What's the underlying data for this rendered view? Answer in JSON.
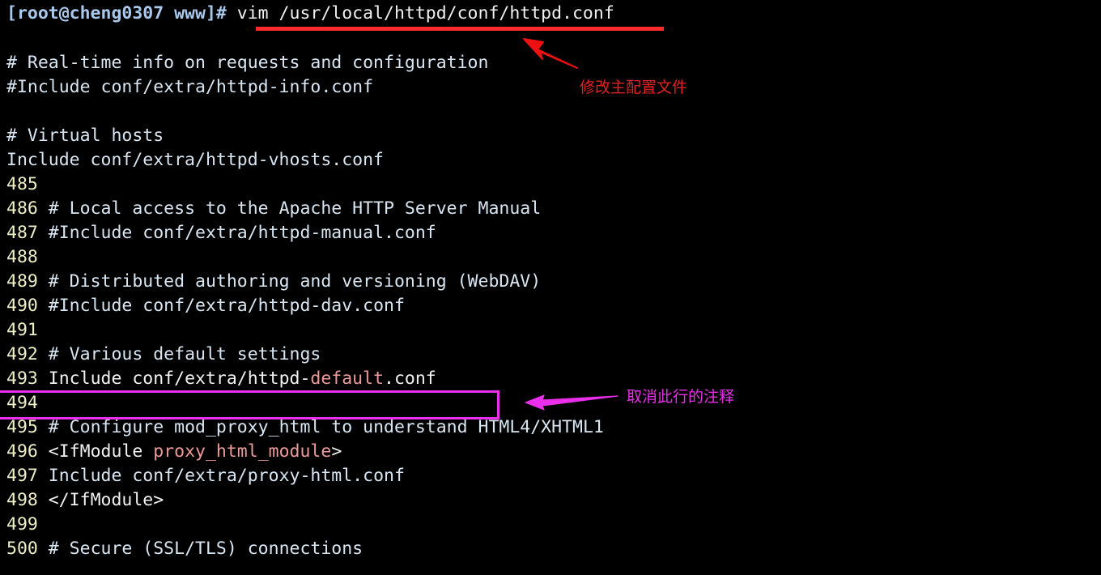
{
  "terminal": {
    "background_color": "#000000",
    "prompt": {
      "user_host": "[root@cheng0307 www]#",
      "command": "vim /usr/local/httpd/conf/httpd.conf"
    },
    "scrollback": [
      {
        "text": "# Real-time info on requests and configuration"
      },
      {
        "text": "#Include conf/extra/httpd-info.conf"
      },
      {
        "text": ""
      },
      {
        "text": "# Virtual hosts"
      },
      {
        "text": "Include conf/extra/httpd-vhosts.conf"
      }
    ],
    "numbered_lines": [
      {
        "num": "485",
        "text": ""
      },
      {
        "num": "486",
        "text": "# Local access to the Apache HTTP Server Manual"
      },
      {
        "num": "487",
        "text": "#Include conf/extra/httpd-manual.conf"
      },
      {
        "num": "488",
        "text": ""
      },
      {
        "num": "489",
        "text": "# Distributed authoring and versioning (WebDAV)"
      },
      {
        "num": "490",
        "text": "#Include conf/extra/httpd-dav.conf"
      },
      {
        "num": "491",
        "text": ""
      },
      {
        "num": "492",
        "text": "# Various default settings"
      },
      {
        "num": "493",
        "pre": "Include conf/extra/httpd-",
        "hl": "default",
        "post": ".conf"
      },
      {
        "num": "494",
        "text": ""
      },
      {
        "num": "495",
        "text": "# Configure mod_proxy_html to understand HTML4/XHTML1"
      },
      {
        "num": "496",
        "pre": "<IfModule ",
        "hl": "proxy_html_module",
        "post": ">"
      },
      {
        "num": "497",
        "text": "Include conf/extra/proxy-html.conf"
      },
      {
        "num": "498",
        "text": "</IfModule>"
      },
      {
        "num": "499",
        "text": ""
      },
      {
        "num": "500",
        "text": "# Secure (SSL/TLS) connections"
      }
    ]
  },
  "annotations": {
    "red": {
      "color": "#e02222",
      "underline_color": "#ff2a2a",
      "note": "修改主配置文件",
      "arrow_direction": "up-left"
    },
    "magenta": {
      "color": "#ea2fea",
      "note": "取消此行的注释",
      "arrow_direction": "left"
    }
  },
  "colors": {
    "line_number": "#efefc7",
    "body_text": "#d8e6f2",
    "prompt_text": "#a8c8ec",
    "highlight_token": "#ec9a9a"
  }
}
